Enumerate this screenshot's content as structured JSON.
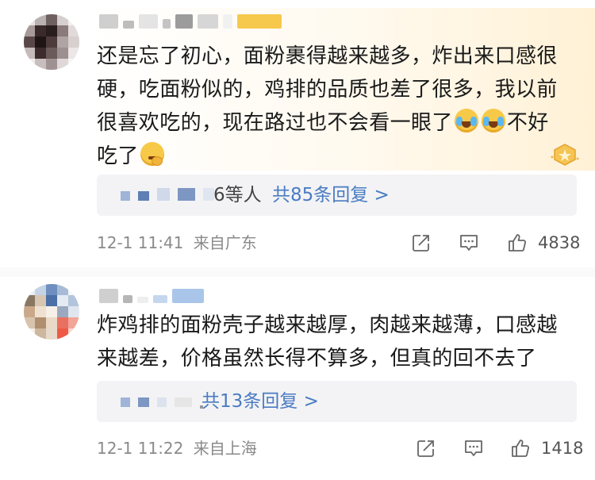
{
  "comments": [
    {
      "text_lines": [
        "还是忘了初心，面粉裹得越来越多，炸出来口感很",
        "硬，吃面粉似的，鸡排的品质也差了很多，我以前",
        "很喜欢吃的，现在路过也不会看一眼了",
        "不好",
        "吃了"
      ],
      "reply_prefix": "6等人",
      "reply_link": "共85条回复 >",
      "time": "12-1 11:41",
      "location": "来自广东",
      "likes": "4838"
    },
    {
      "text_lines": [
        "炸鸡排的面粉壳子越来越厚，肉越来越薄，口感越",
        "来越差，价格虽然长得不算多，但真的回不去了"
      ],
      "reply_link": "共13条回复 >",
      "time": "12-1 11:22",
      "location": "来自上海",
      "likes": "1418"
    }
  ],
  "icons": {
    "share": "share-icon",
    "comment": "comment-icon",
    "like": "thumbs-up-icon",
    "badge": "vip-badge-icon",
    "emoji_cry": "laugh-cry-emoji",
    "emoji_think": "thinking-emoji"
  },
  "colors": {
    "link": "#4a7cc2",
    "meta": "#8a8a8a",
    "reply_bg": "#f3f3f5"
  }
}
